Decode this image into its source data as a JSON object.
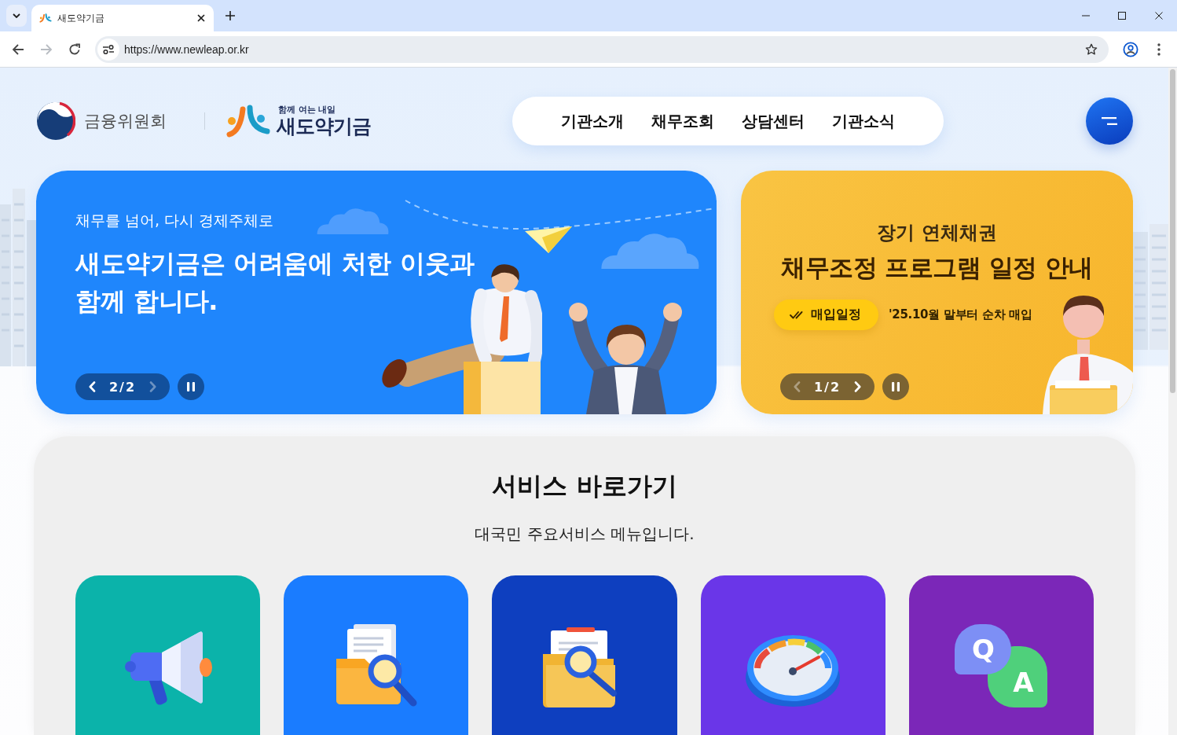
{
  "browser": {
    "tab_title": "새도약기금",
    "url": "https://www.newleap.or.kr",
    "forward_disabled": true
  },
  "header": {
    "agency": "금융위원회",
    "brand_tagline": "함께 여는 내일",
    "brand_name": "새도약기금",
    "nav": [
      {
        "label": "기관소개"
      },
      {
        "label": "채무조회"
      },
      {
        "label": "상담센터"
      },
      {
        "label": "기관소식"
      }
    ]
  },
  "banners": [
    {
      "kind": "main",
      "subtitle": "채무를 넘어, 다시 경제주체로",
      "headline_lines": [
        "새도약기금은 어려움에 처한 이웃과",
        "함께 합니다."
      ],
      "counter": "2/2",
      "prev_disabled": false,
      "next_disabled": true
    },
    {
      "kind": "notice",
      "title": "장기 연체채권",
      "headline": "채무조정 프로그램 일정 안내",
      "badge": "매입일정",
      "note": "'25.10월 말부터 순차 매입",
      "counter": "1/2",
      "prev_disabled": true,
      "next_disabled": false
    }
  ],
  "services": {
    "title": "서비스 바로가기",
    "subtitle": "대국민 주요서비스 메뉴입니다.",
    "tiles": [
      {
        "kind": "megaphone",
        "color": "#0bb3aa"
      },
      {
        "kind": "documents",
        "color": "#1a7cff"
      },
      {
        "kind": "folder",
        "color": "#0e3fbf"
      },
      {
        "kind": "gauge",
        "color": "#6a36e8"
      },
      {
        "kind": "qna",
        "color": "#7b27b8",
        "letters": [
          "Q",
          "A"
        ]
      }
    ]
  }
}
